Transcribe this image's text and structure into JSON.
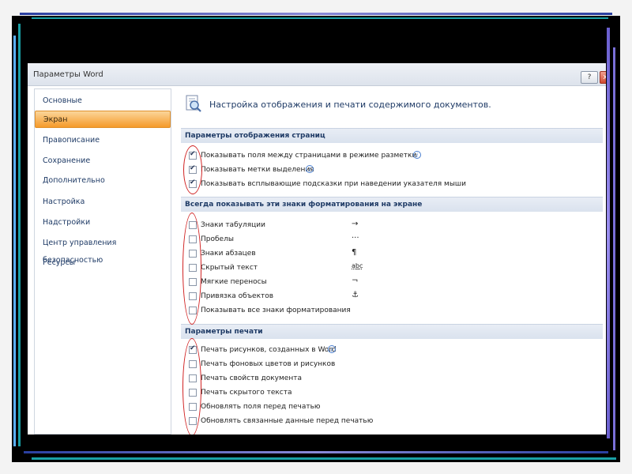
{
  "window": {
    "title": "Параметры Word",
    "help_button": "?",
    "close_button": "x"
  },
  "nav": {
    "items": [
      {
        "label": "Основные"
      },
      {
        "label": "Экран"
      },
      {
        "label": "Правописание"
      },
      {
        "label": "Сохранение"
      },
      {
        "label": "Дополнительно"
      },
      {
        "label": "Настройка"
      },
      {
        "label": "Надстройки"
      },
      {
        "label": "Центр управления безопасностью"
      },
      {
        "label": "Ресурсы"
      }
    ],
    "selected_index": 1
  },
  "content": {
    "header": "Настройка отображения и печати содержимого документов.",
    "header_icon": "magnifier-document-icon",
    "sections": [
      {
        "title": "Параметры отображения страниц",
        "options": [
          {
            "label": "Показывать поля между страницами в режиме разметки",
            "checked": true,
            "info": true
          },
          {
            "label": "Показывать метки выделения",
            "checked": true,
            "info": true
          },
          {
            "label": "Показывать всплывающие подсказки при наведении указателя мыши",
            "checked": true,
            "info": false
          }
        ]
      },
      {
        "title": "Всегда показывать эти знаки форматирования на экране",
        "options": [
          {
            "label": "Знаки табуляции",
            "checked": false,
            "symbol": "→"
          },
          {
            "label": "Пробелы",
            "checked": false,
            "symbol": "···"
          },
          {
            "label": "Знаки абзацев",
            "checked": false,
            "symbol": "¶"
          },
          {
            "label": "Скрытый текст",
            "checked": false,
            "symbol": "ab̲c"
          },
          {
            "label": "Мягкие переносы",
            "checked": false,
            "symbol": "¬"
          },
          {
            "label": "Привязка объектов",
            "checked": false,
            "symbol": "⚓"
          },
          {
            "label": "Показывать все знаки форматирования",
            "checked": false
          }
        ]
      },
      {
        "title": "Параметры печати",
        "options": [
          {
            "label": "Печать рисунков, созданных в Word",
            "checked": true,
            "info": true
          },
          {
            "label": "Печать фоновых цветов и рисунков",
            "checked": false
          },
          {
            "label": "Печать свойств документа",
            "checked": false
          },
          {
            "label": "Печать скрытого текста",
            "checked": false
          },
          {
            "label": "Обновлять поля перед печатью",
            "checked": false
          },
          {
            "label": "Обновлять связанные данные перед печатью",
            "checked": false
          }
        ]
      }
    ]
  },
  "colors": {
    "accent_selected": "#f59a2a",
    "section_text": "#1f3b66",
    "highlight_ellipse": "#d02020",
    "slide_frame": "#000000"
  }
}
